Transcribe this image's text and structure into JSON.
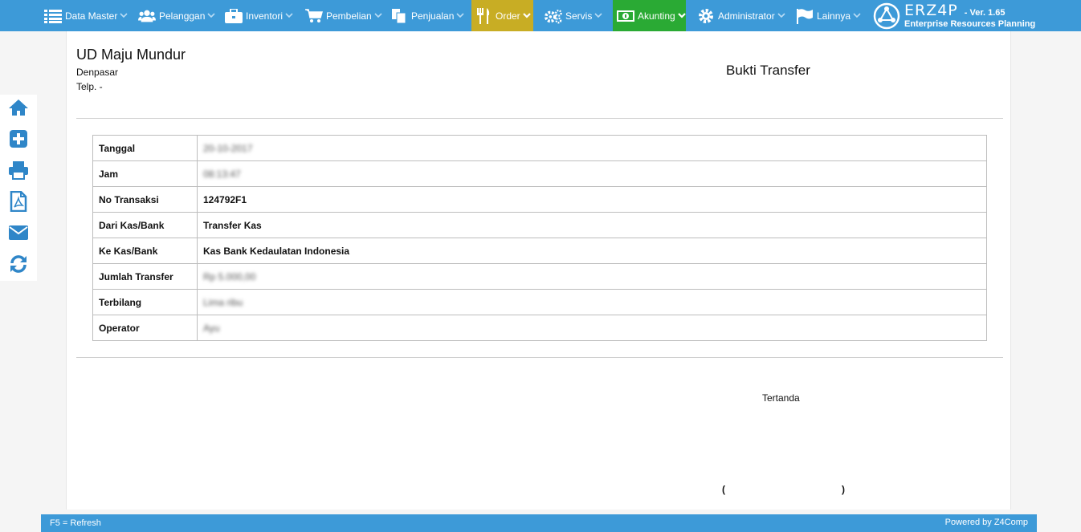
{
  "nav": {
    "data_master": "Data Master",
    "pelanggan": "Pelanggan",
    "inventori": "Inventori",
    "pembelian": "Pembelian",
    "penjualan": "Penjualan",
    "order": "Order",
    "servis": "Servis",
    "akunting": "Akunting",
    "administrator": "Administrator",
    "lainnya": "Lainnya"
  },
  "brand": {
    "name": "ERZ4P",
    "version": "- Ver. 1.65",
    "subtitle": "Enterprise Resources Planning"
  },
  "toolbar_icons": [
    "home-icon",
    "add-icon",
    "print-icon",
    "pdf-icon",
    "email-icon",
    "refresh-icon"
  ],
  "header": {
    "company": "UD Maju Mundur",
    "city": "Denpasar",
    "phone": "Telp. -",
    "title": "Bukti Transfer"
  },
  "details": [
    {
      "label": "Tanggal",
      "value": "20-10-2017",
      "blurred": true
    },
    {
      "label": "Jam",
      "value": "08:13:47",
      "blurred": true
    },
    {
      "label": "No Transaksi",
      "value": "124792F1",
      "blurred": false
    },
    {
      "label": "Dari Kas/Bank",
      "value": "Transfer Kas",
      "blurred": false
    },
    {
      "label": "Ke Kas/Bank",
      "value": "Kas Bank Kedaulatan Indonesia",
      "blurred": false
    },
    {
      "label": "Jumlah Transfer",
      "value": "Rp 5.000,00",
      "blurred": true
    },
    {
      "label": "Terbilang",
      "value": "Lima ribu",
      "blurred": true
    },
    {
      "label": "Operator",
      "value": "Ayu",
      "blurred": true
    }
  ],
  "signature": {
    "label": "Tertanda",
    "open": "(",
    "close": ")"
  },
  "footer": {
    "left": "F5 = Refresh",
    "right": "Powered by Z4Comp"
  },
  "colors": {
    "nav_bg": "#3d9ad8",
    "order_active": "#c8ad24",
    "akunting_active": "#2aaa34",
    "tool_icon": "#2f86c8"
  }
}
